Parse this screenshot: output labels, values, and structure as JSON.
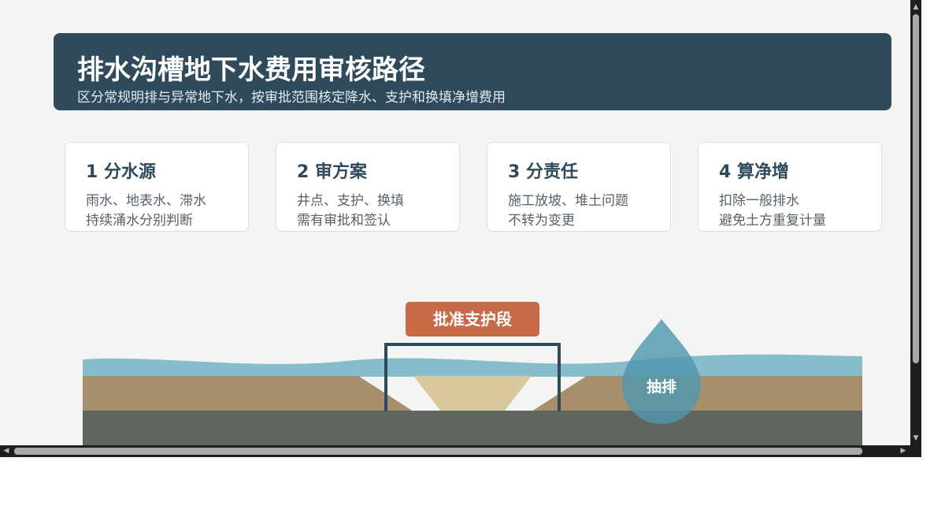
{
  "header": {
    "title": "排水沟槽地下水费用审核路径",
    "subtitle": "区分常规明排与异常地下水，按审批范围核定降水、支护和换填净增费用"
  },
  "steps": [
    {
      "title": "1 分水源",
      "line1": "雨水、地表水、滞水",
      "line2": "持续涌水分别判断"
    },
    {
      "title": "2 审方案",
      "line1": "井点、支护、换填",
      "line2": "需有审批和签认"
    },
    {
      "title": "3 分责任",
      "line1": "施工放坡、堆土问题",
      "line2": "不转为变更"
    },
    {
      "title": "4 算净增",
      "line1": "扣除一般排水",
      "line2": "避免土方重复计量"
    }
  ],
  "diagram": {
    "support_label": "批准支护段",
    "drain_label": "抽排"
  },
  "colors": {
    "header_bg": "#2f4a5a",
    "water": "#86bccb",
    "soil": "#a68f6a",
    "bedrock": "#5f665f",
    "backfill": "#d8c89c",
    "badge": "#c76a47",
    "drop": "#4f97ae"
  }
}
